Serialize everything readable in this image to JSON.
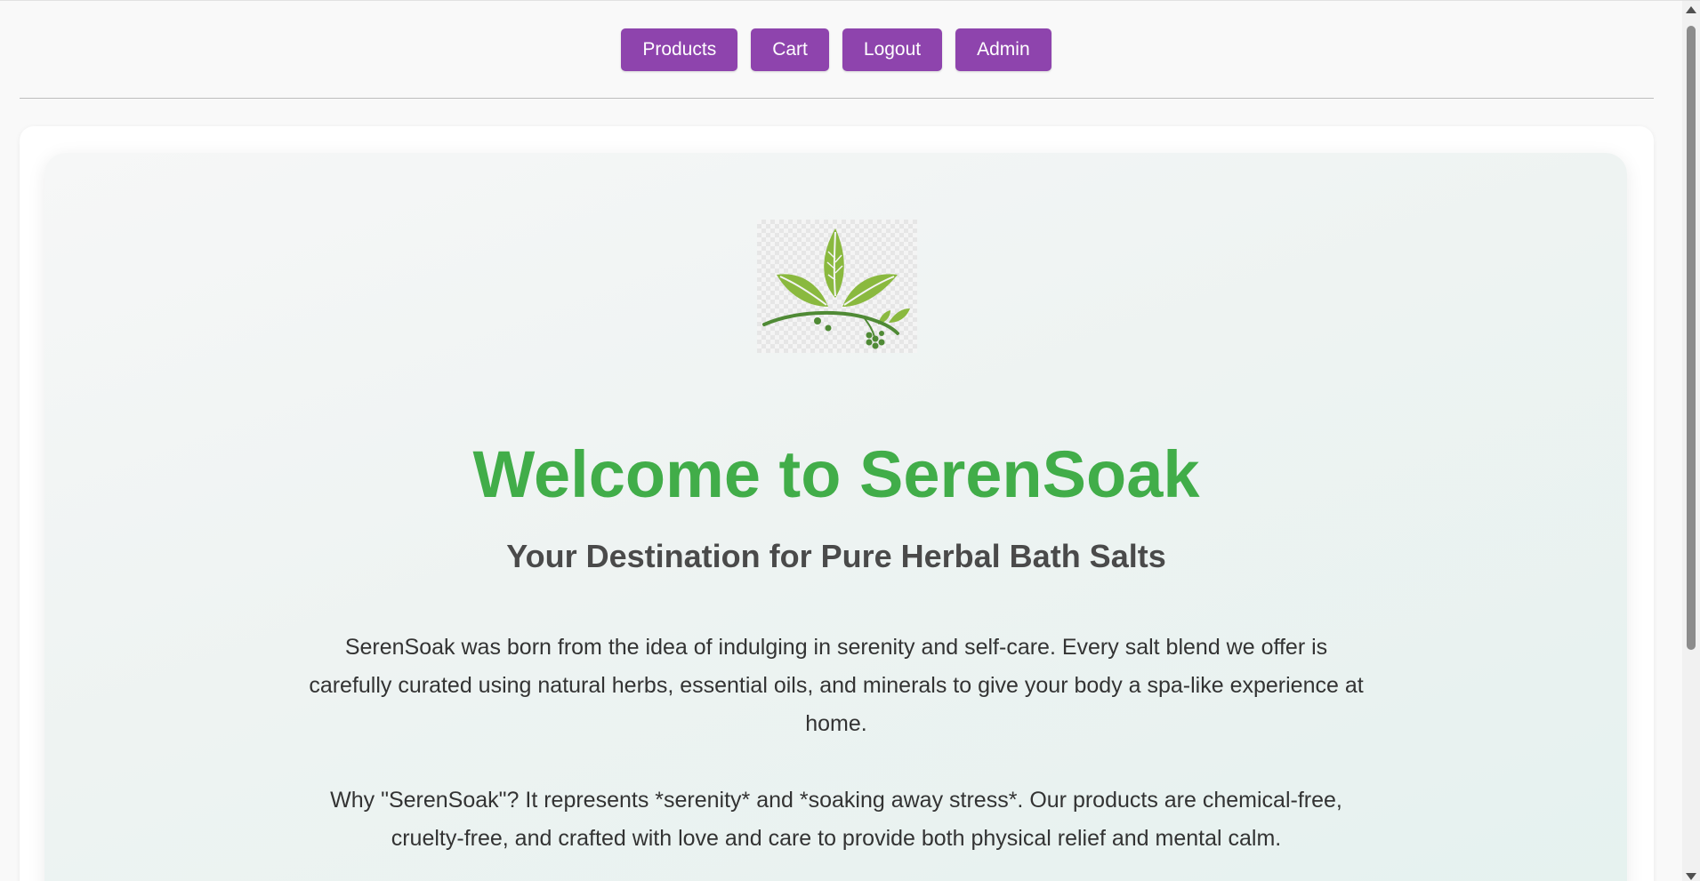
{
  "nav": {
    "items": [
      {
        "label": "Products"
      },
      {
        "label": "Cart"
      },
      {
        "label": "Logout"
      },
      {
        "label": "Admin"
      }
    ],
    "button_color": "#8e44ad"
  },
  "hero": {
    "logo_icon": "herbal-leaves-branch-logo",
    "title": "Welcome to SerenSoak",
    "subtitle": "Your Destination for Pure Herbal Bath Salts",
    "paragraphs": [
      "SerenSoak was born from the idea of indulging in serenity and self-care. Every salt blend we offer is carefully curated using natural herbs, essential oils, and minerals to give your body a spa-like experience at home.",
      "Why \"SerenSoak\"? It represents *serenity* and *soaking away stress*. Our products are chemical-free, cruelty-free, and crafted with love and care to provide both physical relief and mental calm."
    ]
  },
  "colors": {
    "title_green": "#41ad49",
    "subtitle_gray": "#4a4a4a",
    "body_text": "#333333",
    "accent_purple": "#8e44ad"
  }
}
